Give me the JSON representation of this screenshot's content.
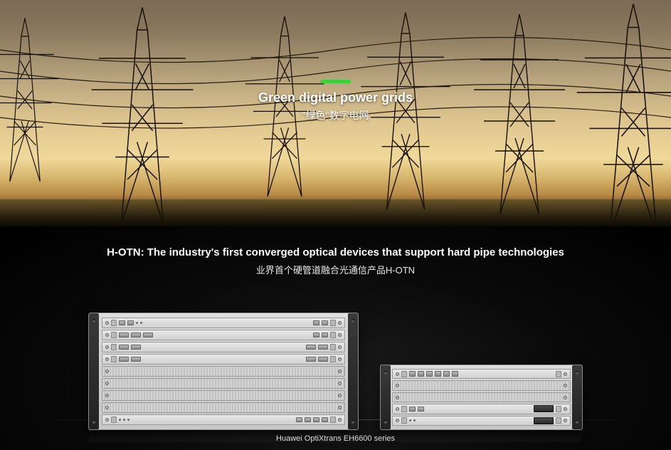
{
  "hero": {
    "title_en": "Green digital power grids",
    "title_cn": "\"绿色\"数字电网"
  },
  "product": {
    "heading_en": "H-OTN: The industry's first converged optical devices that support hard pipe technologies",
    "heading_cn": "业界首个硬管道融合光通信产品H-OTN",
    "caption": "Huawei OptiXtrans EH6600 series"
  }
}
